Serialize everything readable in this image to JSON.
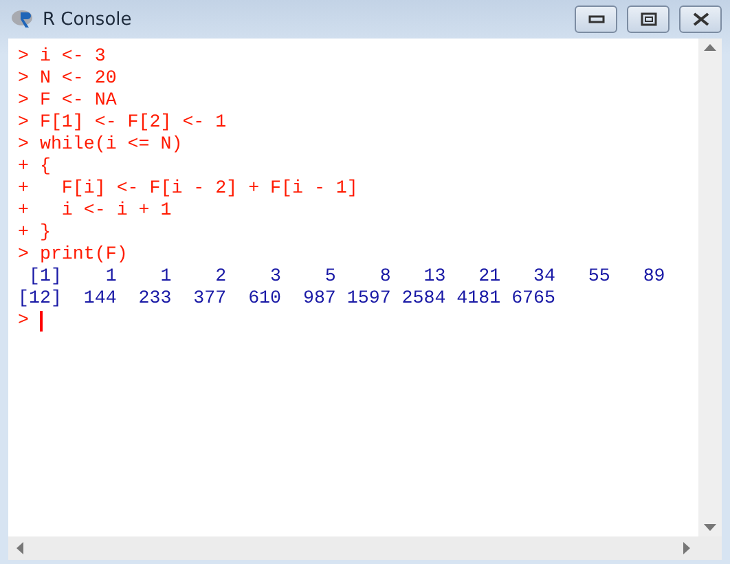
{
  "window": {
    "title": "R Console"
  },
  "console": {
    "lines": [
      {
        "kind": "input",
        "text": "> i <- 3"
      },
      {
        "kind": "input",
        "text": "> N <- 20"
      },
      {
        "kind": "input",
        "text": "> F <- NA"
      },
      {
        "kind": "input",
        "text": "> F[1] <- F[2] <- 1"
      },
      {
        "kind": "input",
        "text": "> while(i <= N)"
      },
      {
        "kind": "input",
        "text": "+ {"
      },
      {
        "kind": "input",
        "text": "+   F[i] <- F[i - 2] + F[i - 1]"
      },
      {
        "kind": "input",
        "text": "+   i <- i + 1"
      },
      {
        "kind": "input",
        "text": "+ }"
      },
      {
        "kind": "input",
        "text": "> print(F)"
      },
      {
        "kind": "output",
        "text": " [1]    1    1    2    3    5    8   13   21   34   55   89"
      },
      {
        "kind": "output",
        "text": "[12]  144  233  377  610  987 1597 2584 4181 6765"
      },
      {
        "kind": "prompt",
        "text": ">",
        "cursor": true
      }
    ]
  }
}
